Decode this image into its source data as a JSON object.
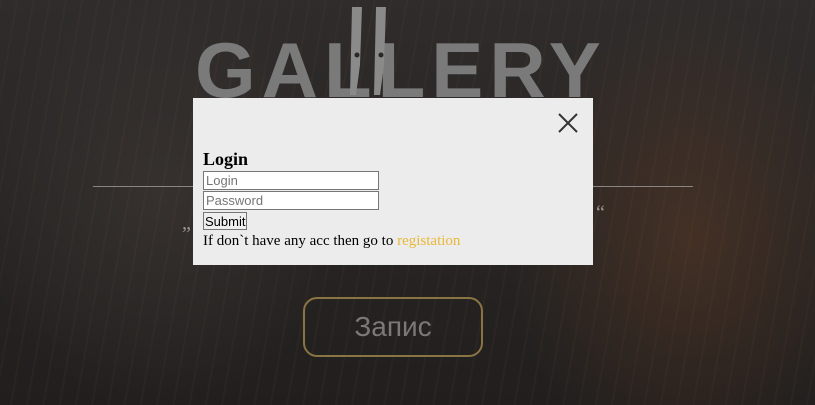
{
  "background": {
    "logo_text": "GALLERY",
    "cta_label": "Запис",
    "quote_open": "„",
    "quote_close": "“"
  },
  "modal": {
    "close_icon": "close-icon",
    "title": "Login",
    "login_placeholder": "Login",
    "password_placeholder": "Password",
    "submit_label": "Submit",
    "register_prefix": "If don`t have any acc then go to ",
    "register_link": "registation"
  },
  "colors": {
    "accent": "#e8b938",
    "modal_bg": "#ececec",
    "cta_border": "#8a7444"
  }
}
